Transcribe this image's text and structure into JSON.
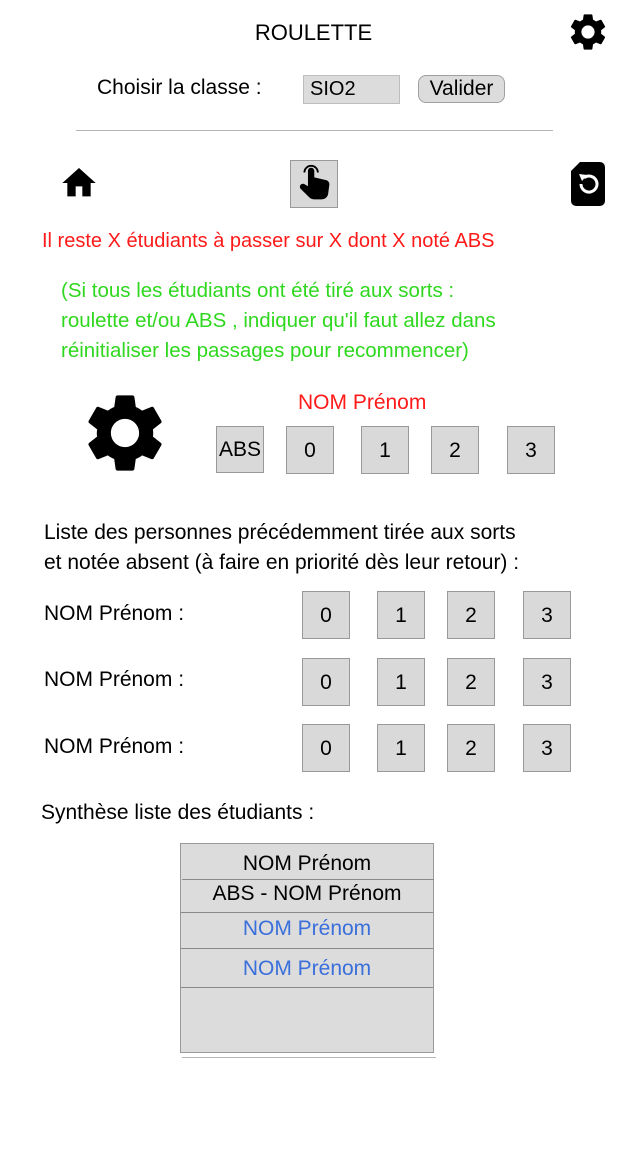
{
  "header": {
    "title": "ROULETTE",
    "settings_icon": "gear-icon"
  },
  "class_selector": {
    "label": "Choisir la classe :",
    "value": "SIO2",
    "validate_label": "Valider"
  },
  "toolbar": {
    "home_icon": "home-icon",
    "spin_icon": "pointer-hand-icon",
    "reset_icon": "file-reset-icon"
  },
  "messages": {
    "remaining": "Il reste X étudiants à passer sur X dont X noté ABS",
    "info_line1": "(Si tous les étudiants ont été tiré aux sorts :",
    "info_line2": "roulette et/ou ABS , indiquer qu'il faut allez dans",
    "info_line3": "réinitialiser les passages pour recommencer)"
  },
  "current": {
    "name": "NOM Prénom",
    "abs_label": "ABS",
    "scores": [
      "0",
      "1",
      "2",
      "3"
    ]
  },
  "absent_list": {
    "title_line1": "Liste des personnes précédemment tirée aux sorts",
    "title_line2": "et notée absent (à faire en priorité dès leur retour) :",
    "rows": [
      {
        "label": "NOM Prénom :",
        "scores": [
          "0",
          "1",
          "2",
          "3"
        ]
      },
      {
        "label": "NOM Prénom :",
        "scores": [
          "0",
          "1",
          "2",
          "3"
        ]
      },
      {
        "label": "NOM Prénom :",
        "scores": [
          "0",
          "1",
          "2",
          "3"
        ]
      }
    ]
  },
  "synthesis": {
    "title": "Synthèse liste des étudiants :",
    "items": [
      "NOM Prénom",
      "ABS - NOM Prénom",
      "NOM Prénom",
      "NOM Prénom"
    ]
  },
  "colors": {
    "red": "#ff1a1a",
    "green": "#2fd81f",
    "blue": "#3a6fdc",
    "button_gray": "#d9d9d9"
  }
}
